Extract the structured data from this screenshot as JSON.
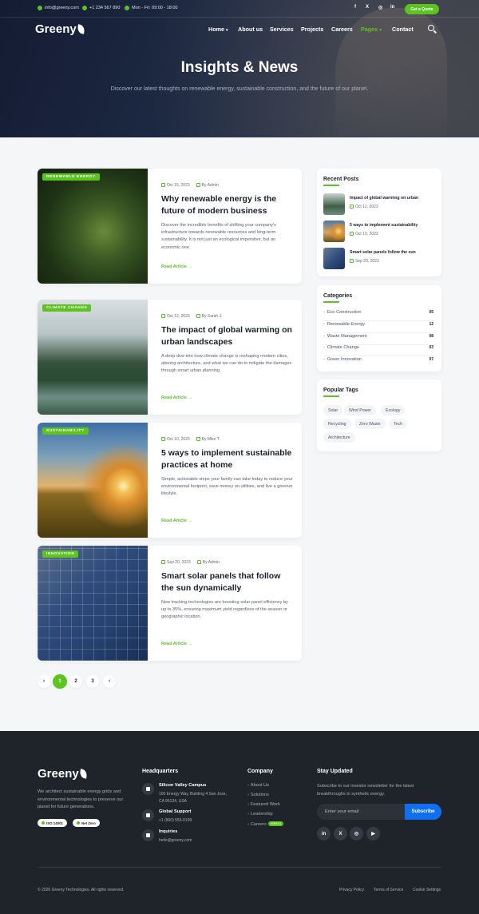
{
  "topbar": {
    "email": "info@greeny.com",
    "phone": "+1 234 567 890",
    "hours": "Mon - Fri: 09:00 - 18:00",
    "social": [
      "f",
      "X",
      "◎",
      "in"
    ],
    "quote_label": "Get a Quote"
  },
  "brand": {
    "name": "Greeny"
  },
  "nav": {
    "items": [
      "Home",
      "About us",
      "Services",
      "Projects",
      "Careers",
      "Pages",
      "Contact"
    ],
    "active": "Pages"
  },
  "hero": {
    "title": "Insights & News",
    "subtitle": "Discover our latest thoughts on renewable energy, sustainable construction, and the future of our planet."
  },
  "posts": [
    {
      "tag": "RENEWABLE ENERGY",
      "date": "Oct 15, 2023",
      "author": "By Admin",
      "title": "Why renewable energy is the future of modern business",
      "excerpt": "Discover the incredible benefits of shifting your company's infrastructure towards renewable resources and long-term sustainability. It is not just an ecological imperative, but an economic one.",
      "read": "Read Article"
    },
    {
      "tag": "CLIMATE CHANGE",
      "date": "Oct 12, 2023",
      "author": "By Sarah J.",
      "title": "The impact of global warming on urban landscapes",
      "excerpt": "A deep dive into how climate change is reshaping modern cities, altering architecture, and what we can do to mitigate the damages through smart urban planning.",
      "read": "Read Article"
    },
    {
      "tag": "SUSTAINABILITY",
      "date": "Oct 10, 2023",
      "author": "By Mike T.",
      "title": "5 ways to implement sustainable practices at home",
      "excerpt": "Simple, actionable steps your family can take today to reduce your environmental footprint, save money on utilities, and live a greener lifestyle.",
      "read": "Read Article"
    },
    {
      "tag": "INNOVATION",
      "date": "Sep 20, 2023",
      "author": "By Admin",
      "title": "Smart solar panels that follow the sun dynamically",
      "excerpt": "New tracking technologies are boosting solar panel efficiency by up to 35%, ensuring maximum yield regardless of the season or geographic location.",
      "read": "Read Article"
    }
  ],
  "pagination": {
    "prev": "‹",
    "pages": [
      "1",
      "2",
      "3"
    ],
    "next": "›",
    "current": "1"
  },
  "sidebar": {
    "recent_title": "Recent Posts",
    "recent": [
      {
        "title": "Impact of global warming on urban",
        "date": "Oct 12, 2023"
      },
      {
        "title": "5 ways to implement sustainability",
        "date": "Oct 10, 2023"
      },
      {
        "title": "Smart solar panels follow the sun",
        "date": "Sep 20, 2023"
      }
    ],
    "categories_title": "Categories",
    "categories": [
      {
        "name": "Eco Construction",
        "count": "05"
      },
      {
        "name": "Renewable Energy",
        "count": "12"
      },
      {
        "name": "Waste Management",
        "count": "08"
      },
      {
        "name": "Climate Change",
        "count": "03"
      },
      {
        "name": "Green Innovation",
        "count": "07"
      }
    ],
    "tags_title": "Popular Tags",
    "tags": [
      "Solar",
      "Wind Power",
      "Ecology",
      "Recycling",
      "Zero Waste",
      "Tech",
      "Architecture"
    ]
  },
  "footer": {
    "brand": "Greeny",
    "description": "We architect sustainable energy grids and environmental technologies to preserve our planet for future generations.",
    "badges": [
      "ISO 14001",
      "Net Zero"
    ],
    "hq_title": "Headquarters",
    "locations": [
      {
        "title": "Silicon Valley Campus",
        "detail": "100 Energy Way, Building 4 San Jose, CA 95134, USA"
      },
      {
        "title": "Global Support",
        "detail": "+1 (800) 555-0199"
      },
      {
        "title": "Inquiries",
        "detail": "hello@greeny.com"
      }
    ],
    "company_title": "Company",
    "company_links": [
      "About Us",
      "Solutions",
      "Featured Work",
      "Leadership",
      "Careers"
    ],
    "hiring_badge": "HIRING",
    "newsletter_title": "Stay Updated",
    "newsletter_text": "Subscribe to our investor newsletter for the latest breakthroughs in synthetic energy.",
    "email_placeholder": "Enter your email",
    "subscribe_label": "Subscribe",
    "social": [
      "in",
      "X",
      "◎",
      "▶"
    ],
    "copyright": "© 2026 Greeny Technologies. All rights reserved.",
    "bottom_links": [
      "Privacy Policy",
      "Terms of Service",
      "Cookie Settings"
    ]
  },
  "colors": {
    "accent": "#5cc320",
    "dark": "#1f232a",
    "blue": "#0f6ff0"
  }
}
